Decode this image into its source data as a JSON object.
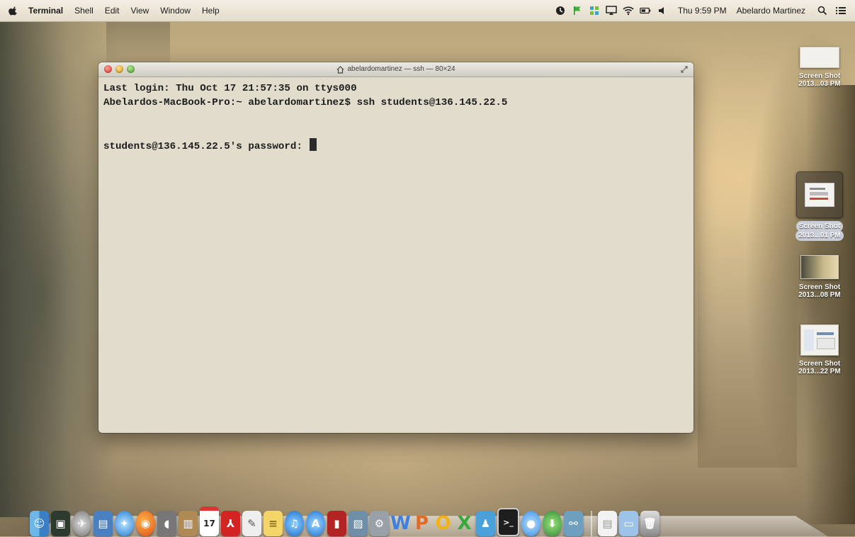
{
  "menubar": {
    "apple_icon": "apple-icon",
    "app_name": "Terminal",
    "items": [
      "Shell",
      "Edit",
      "View",
      "Window",
      "Help"
    ],
    "status_icons": [
      "time-machine-icon",
      "flag-icon",
      "puzzle-icon",
      "airplay-icon",
      "wifi-icon",
      "battery-icon",
      "volume-icon"
    ],
    "clock": "Thu 9:59 PM",
    "user": "Abelardo Martinez",
    "spotlight_icon": "search-icon",
    "notification_icon": "list-icon"
  },
  "terminal": {
    "title": "abelardomartinez — ssh — 80×24",
    "lines": [
      "Last login: Thu Oct 17 21:57:35 on ttys000",
      "Abelardos-MacBook-Pro:~ abelardomartinez$ ssh students@136.145.22.5",
      "",
      "",
      "students@136.145.22.5's password: "
    ]
  },
  "desktop_icons": [
    {
      "label1": "Screen Shot",
      "label2": "2013...03 PM"
    },
    {
      "label1": "Screen Shot",
      "label2": "2013...01 PM"
    },
    {
      "label1": "Screen Shot",
      "label2": "2013...08 PM"
    },
    {
      "label1": "Screen Shot",
      "label2": "2013...22 PM"
    }
  ],
  "dock": {
    "calendar_day": "17",
    "items": [
      "finder-icon",
      "dashboard-icon",
      "launchpad-icon",
      "preview-icon",
      "safari-icon",
      "firefox-icon",
      "facetime-icon",
      "contacts-icon",
      "calendar-icon",
      "acrobat-icon",
      "textedit-icon",
      "notes-icon",
      "itunes-icon",
      "app-store-icon",
      "photo-booth-icon",
      "iphoto-icon",
      "system-preferences-icon",
      "word-icon",
      "powerpoint-icon",
      "outlook-icon",
      "excel-icon",
      "messenger-icon",
      "terminal-icon",
      "messages-icon",
      "download-icon",
      "network-icon",
      "documents-icon",
      "downloads-folder-icon",
      "trash-icon"
    ]
  },
  "colors": {
    "terminal_bg": "#e1dccc",
    "close": "#d8392b",
    "minimize": "#d9961a",
    "maximize": "#4c9d2d"
  }
}
